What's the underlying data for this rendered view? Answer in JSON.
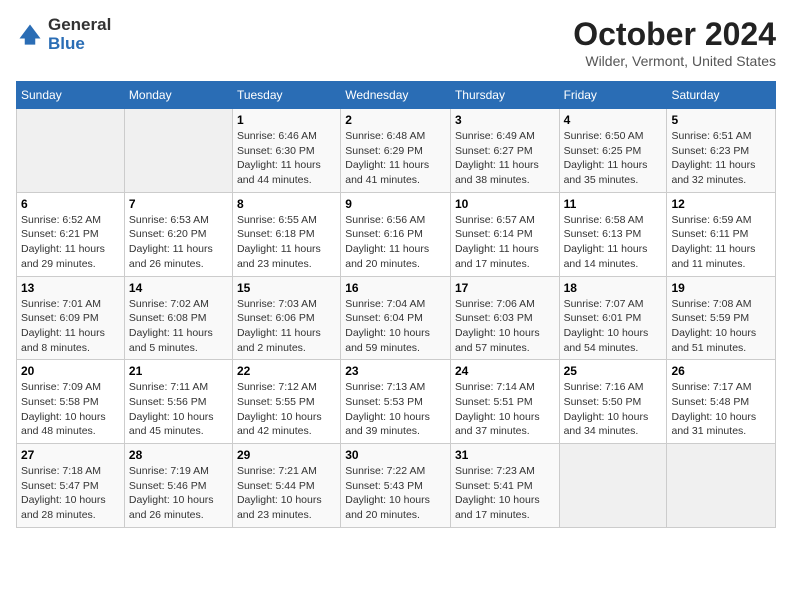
{
  "header": {
    "logo_general": "General",
    "logo_blue": "Blue",
    "month": "October 2024",
    "location": "Wilder, Vermont, United States"
  },
  "weekdays": [
    "Sunday",
    "Monday",
    "Tuesday",
    "Wednesday",
    "Thursday",
    "Friday",
    "Saturday"
  ],
  "weeks": [
    [
      {
        "num": "",
        "detail": ""
      },
      {
        "num": "",
        "detail": ""
      },
      {
        "num": "1",
        "detail": "Sunrise: 6:46 AM\nSunset: 6:30 PM\nDaylight: 11 hours and 44 minutes."
      },
      {
        "num": "2",
        "detail": "Sunrise: 6:48 AM\nSunset: 6:29 PM\nDaylight: 11 hours and 41 minutes."
      },
      {
        "num": "3",
        "detail": "Sunrise: 6:49 AM\nSunset: 6:27 PM\nDaylight: 11 hours and 38 minutes."
      },
      {
        "num": "4",
        "detail": "Sunrise: 6:50 AM\nSunset: 6:25 PM\nDaylight: 11 hours and 35 minutes."
      },
      {
        "num": "5",
        "detail": "Sunrise: 6:51 AM\nSunset: 6:23 PM\nDaylight: 11 hours and 32 minutes."
      }
    ],
    [
      {
        "num": "6",
        "detail": "Sunrise: 6:52 AM\nSunset: 6:21 PM\nDaylight: 11 hours and 29 minutes."
      },
      {
        "num": "7",
        "detail": "Sunrise: 6:53 AM\nSunset: 6:20 PM\nDaylight: 11 hours and 26 minutes."
      },
      {
        "num": "8",
        "detail": "Sunrise: 6:55 AM\nSunset: 6:18 PM\nDaylight: 11 hours and 23 minutes."
      },
      {
        "num": "9",
        "detail": "Sunrise: 6:56 AM\nSunset: 6:16 PM\nDaylight: 11 hours and 20 minutes."
      },
      {
        "num": "10",
        "detail": "Sunrise: 6:57 AM\nSunset: 6:14 PM\nDaylight: 11 hours and 17 minutes."
      },
      {
        "num": "11",
        "detail": "Sunrise: 6:58 AM\nSunset: 6:13 PM\nDaylight: 11 hours and 14 minutes."
      },
      {
        "num": "12",
        "detail": "Sunrise: 6:59 AM\nSunset: 6:11 PM\nDaylight: 11 hours and 11 minutes."
      }
    ],
    [
      {
        "num": "13",
        "detail": "Sunrise: 7:01 AM\nSunset: 6:09 PM\nDaylight: 11 hours and 8 minutes."
      },
      {
        "num": "14",
        "detail": "Sunrise: 7:02 AM\nSunset: 6:08 PM\nDaylight: 11 hours and 5 minutes."
      },
      {
        "num": "15",
        "detail": "Sunrise: 7:03 AM\nSunset: 6:06 PM\nDaylight: 11 hours and 2 minutes."
      },
      {
        "num": "16",
        "detail": "Sunrise: 7:04 AM\nSunset: 6:04 PM\nDaylight: 10 hours and 59 minutes."
      },
      {
        "num": "17",
        "detail": "Sunrise: 7:06 AM\nSunset: 6:03 PM\nDaylight: 10 hours and 57 minutes."
      },
      {
        "num": "18",
        "detail": "Sunrise: 7:07 AM\nSunset: 6:01 PM\nDaylight: 10 hours and 54 minutes."
      },
      {
        "num": "19",
        "detail": "Sunrise: 7:08 AM\nSunset: 5:59 PM\nDaylight: 10 hours and 51 minutes."
      }
    ],
    [
      {
        "num": "20",
        "detail": "Sunrise: 7:09 AM\nSunset: 5:58 PM\nDaylight: 10 hours and 48 minutes."
      },
      {
        "num": "21",
        "detail": "Sunrise: 7:11 AM\nSunset: 5:56 PM\nDaylight: 10 hours and 45 minutes."
      },
      {
        "num": "22",
        "detail": "Sunrise: 7:12 AM\nSunset: 5:55 PM\nDaylight: 10 hours and 42 minutes."
      },
      {
        "num": "23",
        "detail": "Sunrise: 7:13 AM\nSunset: 5:53 PM\nDaylight: 10 hours and 39 minutes."
      },
      {
        "num": "24",
        "detail": "Sunrise: 7:14 AM\nSunset: 5:51 PM\nDaylight: 10 hours and 37 minutes."
      },
      {
        "num": "25",
        "detail": "Sunrise: 7:16 AM\nSunset: 5:50 PM\nDaylight: 10 hours and 34 minutes."
      },
      {
        "num": "26",
        "detail": "Sunrise: 7:17 AM\nSunset: 5:48 PM\nDaylight: 10 hours and 31 minutes."
      }
    ],
    [
      {
        "num": "27",
        "detail": "Sunrise: 7:18 AM\nSunset: 5:47 PM\nDaylight: 10 hours and 28 minutes."
      },
      {
        "num": "28",
        "detail": "Sunrise: 7:19 AM\nSunset: 5:46 PM\nDaylight: 10 hours and 26 minutes."
      },
      {
        "num": "29",
        "detail": "Sunrise: 7:21 AM\nSunset: 5:44 PM\nDaylight: 10 hours and 23 minutes."
      },
      {
        "num": "30",
        "detail": "Sunrise: 7:22 AM\nSunset: 5:43 PM\nDaylight: 10 hours and 20 minutes."
      },
      {
        "num": "31",
        "detail": "Sunrise: 7:23 AM\nSunset: 5:41 PM\nDaylight: 10 hours and 17 minutes."
      },
      {
        "num": "",
        "detail": ""
      },
      {
        "num": "",
        "detail": ""
      }
    ]
  ]
}
